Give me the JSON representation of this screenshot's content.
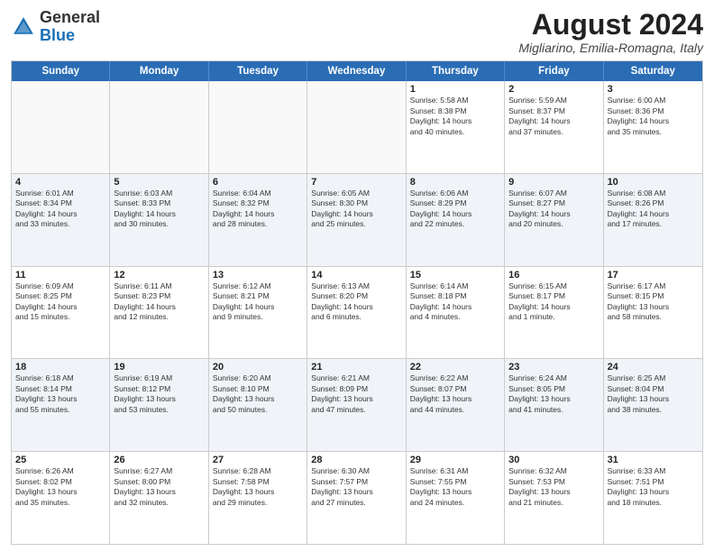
{
  "header": {
    "logo_general": "General",
    "logo_blue": "Blue",
    "month_title": "August 2024",
    "location": "Migliarino, Emilia-Romagna, Italy"
  },
  "days_of_week": [
    "Sunday",
    "Monday",
    "Tuesday",
    "Wednesday",
    "Thursday",
    "Friday",
    "Saturday"
  ],
  "weeks": [
    [
      {
        "day": "",
        "info": "",
        "empty": true
      },
      {
        "day": "",
        "info": "",
        "empty": true
      },
      {
        "day": "",
        "info": "",
        "empty": true
      },
      {
        "day": "",
        "info": "",
        "empty": true
      },
      {
        "day": "1",
        "info": "Sunrise: 5:58 AM\nSunset: 8:38 PM\nDaylight: 14 hours\nand 40 minutes."
      },
      {
        "day": "2",
        "info": "Sunrise: 5:59 AM\nSunset: 8:37 PM\nDaylight: 14 hours\nand 37 minutes."
      },
      {
        "day": "3",
        "info": "Sunrise: 6:00 AM\nSunset: 8:36 PM\nDaylight: 14 hours\nand 35 minutes."
      }
    ],
    [
      {
        "day": "4",
        "info": "Sunrise: 6:01 AM\nSunset: 8:34 PM\nDaylight: 14 hours\nand 33 minutes."
      },
      {
        "day": "5",
        "info": "Sunrise: 6:03 AM\nSunset: 8:33 PM\nDaylight: 14 hours\nand 30 minutes."
      },
      {
        "day": "6",
        "info": "Sunrise: 6:04 AM\nSunset: 8:32 PM\nDaylight: 14 hours\nand 28 minutes."
      },
      {
        "day": "7",
        "info": "Sunrise: 6:05 AM\nSunset: 8:30 PM\nDaylight: 14 hours\nand 25 minutes."
      },
      {
        "day": "8",
        "info": "Sunrise: 6:06 AM\nSunset: 8:29 PM\nDaylight: 14 hours\nand 22 minutes."
      },
      {
        "day": "9",
        "info": "Sunrise: 6:07 AM\nSunset: 8:27 PM\nDaylight: 14 hours\nand 20 minutes."
      },
      {
        "day": "10",
        "info": "Sunrise: 6:08 AM\nSunset: 8:26 PM\nDaylight: 14 hours\nand 17 minutes."
      }
    ],
    [
      {
        "day": "11",
        "info": "Sunrise: 6:09 AM\nSunset: 8:25 PM\nDaylight: 14 hours\nand 15 minutes."
      },
      {
        "day": "12",
        "info": "Sunrise: 6:11 AM\nSunset: 8:23 PM\nDaylight: 14 hours\nand 12 minutes."
      },
      {
        "day": "13",
        "info": "Sunrise: 6:12 AM\nSunset: 8:21 PM\nDaylight: 14 hours\nand 9 minutes."
      },
      {
        "day": "14",
        "info": "Sunrise: 6:13 AM\nSunset: 8:20 PM\nDaylight: 14 hours\nand 6 minutes."
      },
      {
        "day": "15",
        "info": "Sunrise: 6:14 AM\nSunset: 8:18 PM\nDaylight: 14 hours\nand 4 minutes."
      },
      {
        "day": "16",
        "info": "Sunrise: 6:15 AM\nSunset: 8:17 PM\nDaylight: 14 hours\nand 1 minute."
      },
      {
        "day": "17",
        "info": "Sunrise: 6:17 AM\nSunset: 8:15 PM\nDaylight: 13 hours\nand 58 minutes."
      }
    ],
    [
      {
        "day": "18",
        "info": "Sunrise: 6:18 AM\nSunset: 8:14 PM\nDaylight: 13 hours\nand 55 minutes."
      },
      {
        "day": "19",
        "info": "Sunrise: 6:19 AM\nSunset: 8:12 PM\nDaylight: 13 hours\nand 53 minutes."
      },
      {
        "day": "20",
        "info": "Sunrise: 6:20 AM\nSunset: 8:10 PM\nDaylight: 13 hours\nand 50 minutes."
      },
      {
        "day": "21",
        "info": "Sunrise: 6:21 AM\nSunset: 8:09 PM\nDaylight: 13 hours\nand 47 minutes."
      },
      {
        "day": "22",
        "info": "Sunrise: 6:22 AM\nSunset: 8:07 PM\nDaylight: 13 hours\nand 44 minutes."
      },
      {
        "day": "23",
        "info": "Sunrise: 6:24 AM\nSunset: 8:05 PM\nDaylight: 13 hours\nand 41 minutes."
      },
      {
        "day": "24",
        "info": "Sunrise: 6:25 AM\nSunset: 8:04 PM\nDaylight: 13 hours\nand 38 minutes."
      }
    ],
    [
      {
        "day": "25",
        "info": "Sunrise: 6:26 AM\nSunset: 8:02 PM\nDaylight: 13 hours\nand 35 minutes."
      },
      {
        "day": "26",
        "info": "Sunrise: 6:27 AM\nSunset: 8:00 PM\nDaylight: 13 hours\nand 32 minutes."
      },
      {
        "day": "27",
        "info": "Sunrise: 6:28 AM\nSunset: 7:58 PM\nDaylight: 13 hours\nand 29 minutes."
      },
      {
        "day": "28",
        "info": "Sunrise: 6:30 AM\nSunset: 7:57 PM\nDaylight: 13 hours\nand 27 minutes."
      },
      {
        "day": "29",
        "info": "Sunrise: 6:31 AM\nSunset: 7:55 PM\nDaylight: 13 hours\nand 24 minutes."
      },
      {
        "day": "30",
        "info": "Sunrise: 6:32 AM\nSunset: 7:53 PM\nDaylight: 13 hours\nand 21 minutes."
      },
      {
        "day": "31",
        "info": "Sunrise: 6:33 AM\nSunset: 7:51 PM\nDaylight: 13 hours\nand 18 minutes."
      }
    ]
  ]
}
